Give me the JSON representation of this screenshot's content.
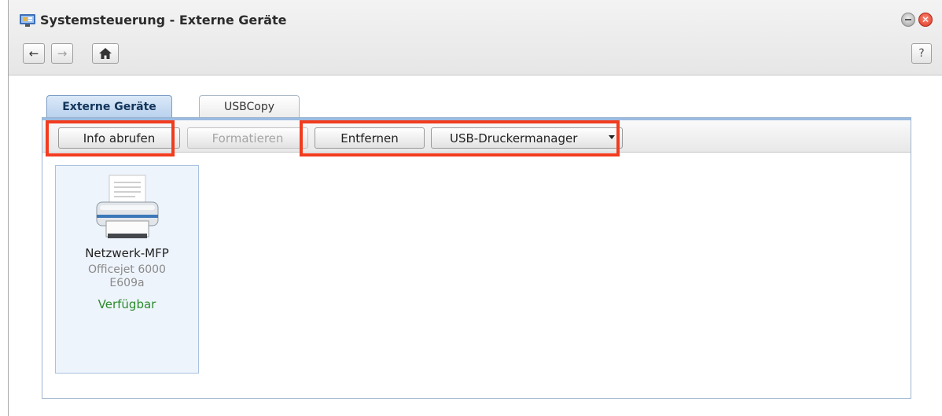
{
  "window": {
    "title": "Systemsteuerung - Externe Geräte"
  },
  "nav": {
    "back_icon": "←",
    "forward_icon": "→",
    "home_icon": "home-icon",
    "help_label": "?"
  },
  "tabs": [
    {
      "label": "Externe Geräte",
      "active": true
    },
    {
      "label": "USBCopy",
      "active": false
    }
  ],
  "toolbar": {
    "info_label": "Info abrufen",
    "format_label": "Formatieren",
    "remove_label": "Entfernen",
    "usb_printer_label": "USB-Druckermanager"
  },
  "devices": [
    {
      "name": "Netzwerk-MFP",
      "model": "Officejet 6000 E609a",
      "status": "Verfügbar"
    }
  ],
  "colors": {
    "highlight": "#f13c1f",
    "status_ok": "#2b8a2b",
    "tab_active": "#b9d2ee"
  }
}
